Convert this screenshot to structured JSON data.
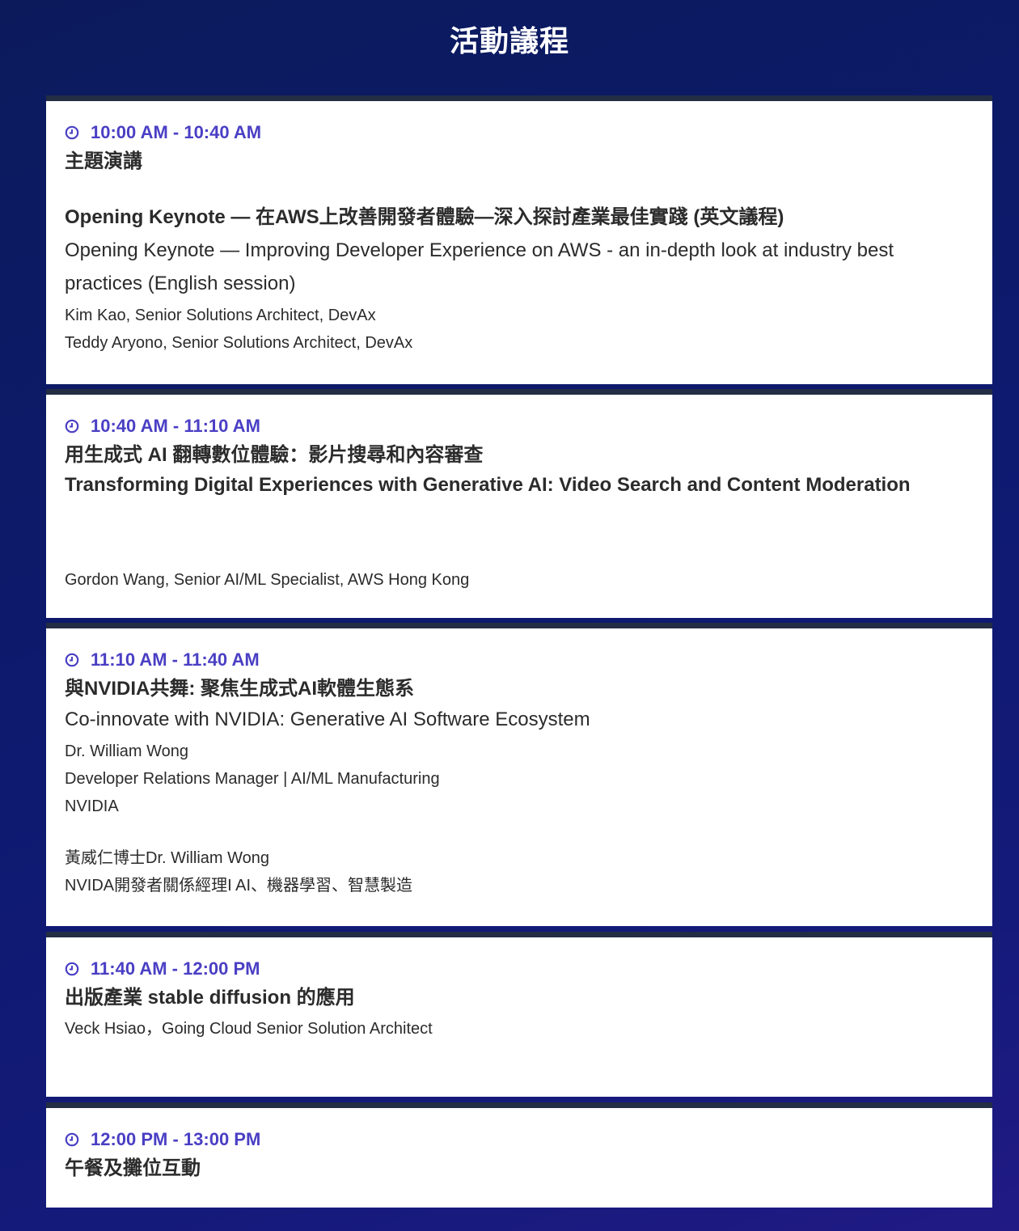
{
  "page": {
    "title": "活動議程"
  },
  "sessions": [
    {
      "time": "10:00 AM - 10:40 AM",
      "title_zh": "主題演講",
      "title_bold": "Opening Keynote — 在AWS上改善開發者體驗—深入探討產業最佳實踐 (英文議程)",
      "title_en": "Opening Keynote — Improving Developer Experience on AWS - an in-depth look at industry best practices (English session)",
      "speakers": [
        "Kim Kao, Senior Solutions Architect, DevAx",
        "Teddy Aryono, Senior Solutions Architect, DevAx"
      ]
    },
    {
      "time": "10:40 AM - 11:10 AM",
      "title_zh": "用生成式 AI 翻轉數位體驗：影片搜尋和內容審查",
      "title_bold": "Transforming Digital Experiences with Generative AI: Video Search and Content Moderation",
      "speakers": [
        "Gordon Wang, Senior AI/ML Specialist, AWS Hong Kong"
      ]
    },
    {
      "time": "11:10 AM - 11:40 AM",
      "title_zh": "與NVIDIA共舞: 聚焦生成式AI軟體生態系",
      "title_en": "Co-innovate with NVIDIA: Generative AI Software Ecosystem",
      "speakers": [
        "Dr. William Wong",
        "Developer Relations Manager | AI/ML Manufacturing",
        "NVIDIA",
        "黃威仁博士Dr. William Wong",
        "NVIDA開發者關係經理I AI、機器學習、智慧製造"
      ]
    },
    {
      "time": "11:40 AM - 12:00 PM",
      "title_zh": "出版產業 stable diffusion 的應用",
      "speakers": [
        "Veck Hsiao，Going Cloud Senior Solution Architect"
      ]
    },
    {
      "time": "12:00 PM - 13:00 PM",
      "title_zh": "午餐及攤位互動"
    }
  ],
  "colors": {
    "accent": "#4a3fc4",
    "card_border": "#232d44",
    "background": "#0d1a6e"
  },
  "icons": {
    "clock": "clock-icon"
  }
}
